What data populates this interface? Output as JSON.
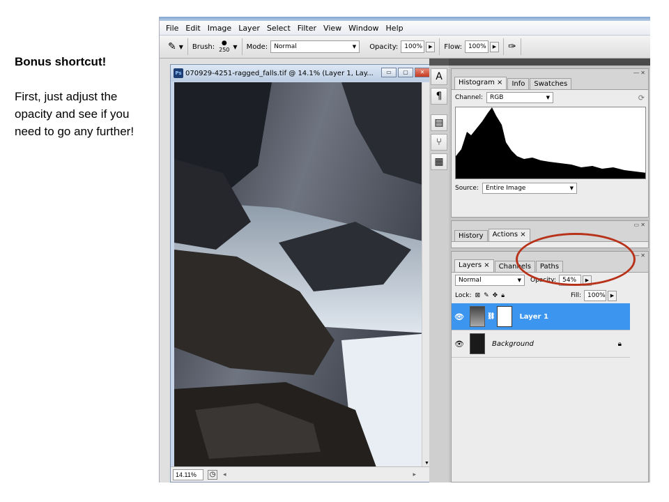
{
  "slide": {
    "title": "Bonus shortcut!",
    "body": "First, just adjust the opacity and see if you need to go any further!"
  },
  "menu": [
    "File",
    "Edit",
    "Image",
    "Layer",
    "Select",
    "Filter",
    "View",
    "Window",
    "Help"
  ],
  "options": {
    "brush_label": "Brush:",
    "brush_size": "250",
    "mode_label": "Mode:",
    "mode_value": "Normal",
    "opacity_label": "Opacity:",
    "opacity_value": "100%",
    "flow_label": "Flow:",
    "flow_value": "100%"
  },
  "document": {
    "title": "070929-4251-ragged_falls.tif @ 14.1% (Layer 1, Lay...",
    "ps_badge": "Ps",
    "zoom": "14.11%"
  },
  "histogram": {
    "tabs": [
      "Histogram ×",
      "Info",
      "Swatches"
    ],
    "channel_label": "Channel:",
    "channel_value": "RGB",
    "source_label": "Source:",
    "source_value": "Entire Image"
  },
  "history": {
    "tabs": [
      "History",
      "Actions ×"
    ]
  },
  "layers": {
    "tabs": [
      "Layers ×",
      "Channels",
      "Paths"
    ],
    "blend_mode": "Normal",
    "opacity_label": "Opacity:",
    "opacity_value": "54%",
    "lock_label": "Lock:",
    "fill_label": "Fill:",
    "fill_value": "100%",
    "items": [
      {
        "name": "Layer 1",
        "selected": true
      },
      {
        "name": "Background",
        "selected": false
      }
    ]
  },
  "colors": {
    "highlight": "#b8321a",
    "selected_layer": "#3c96f0"
  }
}
